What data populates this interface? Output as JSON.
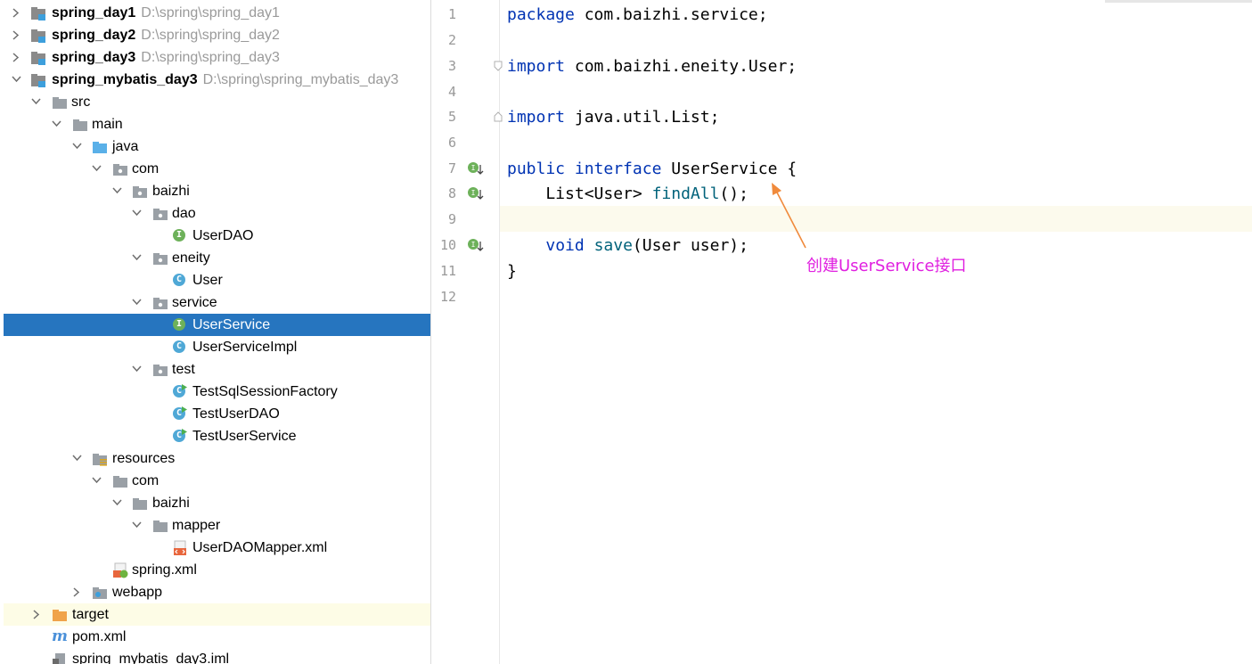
{
  "project_tree": {
    "items": [
      {
        "label": "spring_day1",
        "path": "D:\\spring\\spring_day1"
      },
      {
        "label": "spring_day2",
        "path": "D:\\spring\\spring_day2"
      },
      {
        "label": "spring_day3",
        "path": "D:\\spring\\spring_day3"
      },
      {
        "label": "spring_mybatis_day3",
        "path": "D:\\spring\\spring_mybatis_day3"
      },
      {
        "label": "src"
      },
      {
        "label": "main"
      },
      {
        "label": "java"
      },
      {
        "label": "com"
      },
      {
        "label": "baizhi"
      },
      {
        "label": "dao"
      },
      {
        "label": "UserDAO"
      },
      {
        "label": "eneity"
      },
      {
        "label": "User"
      },
      {
        "label": "service"
      },
      {
        "label": "UserService"
      },
      {
        "label": "UserServiceImpl"
      },
      {
        "label": "test"
      },
      {
        "label": "TestSqlSessionFactory"
      },
      {
        "label": "TestUserDAO"
      },
      {
        "label": "TestUserService"
      },
      {
        "label": "resources"
      },
      {
        "label": "com"
      },
      {
        "label": "baizhi"
      },
      {
        "label": "mapper"
      },
      {
        "label": "UserDAOMapper.xml"
      },
      {
        "label": "spring.xml"
      },
      {
        "label": "webapp"
      },
      {
        "label": "target"
      },
      {
        "label": "pom.xml"
      },
      {
        "label": "spring_mybatis_day3.iml"
      }
    ]
  },
  "editor": {
    "line_numbers": [
      "1",
      "2",
      "3",
      "4",
      "5",
      "6",
      "7",
      "8",
      "9",
      "10",
      "11",
      "12"
    ],
    "code": {
      "l1_kw": "package",
      "l1_rest": " com.baizhi.service;",
      "l3_kw": "import",
      "l3_rest": " com.baizhi.eneity.User;",
      "l5_kw": "import",
      "l5_rest": " java.util.List;",
      "l7_kw1": "public",
      "l7_kw2": "interface",
      "l7_rest": " UserService {",
      "l8_pre": "    List<User> ",
      "l8_method": "findAll",
      "l8_post": "();",
      "l10_pre": "    ",
      "l10_kw": "void",
      "l10_sp": " ",
      "l10_method": "save",
      "l10_post": "(User user);",
      "l11": "}"
    }
  },
  "annotation": {
    "text": "创建UserService接口",
    "color": "#e020e0",
    "arrow_color": "#f08a3c"
  },
  "colors": {
    "selection": "#2675bf",
    "keyword": "#0033b3",
    "method": "#00627a",
    "interface_badge": "#6db15a",
    "class_badge": "#4fa8d6"
  }
}
